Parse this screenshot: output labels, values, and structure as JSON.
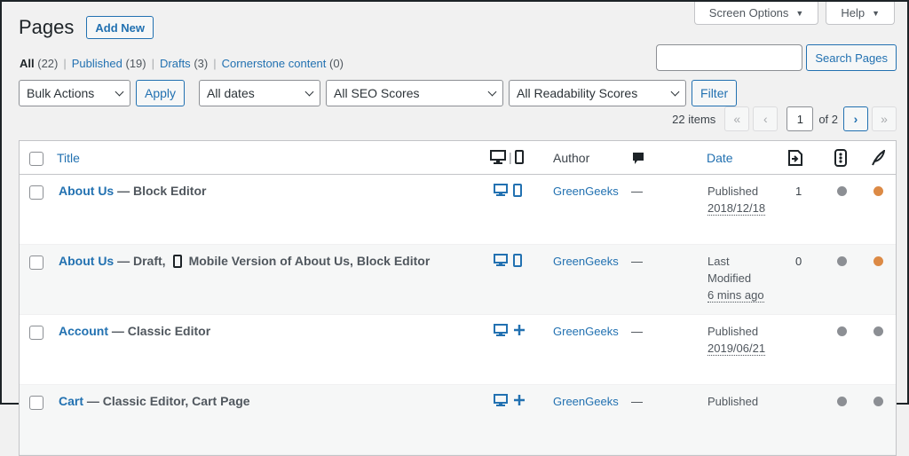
{
  "top_tabs": [
    {
      "label": "Screen Options"
    },
    {
      "label": "Help"
    }
  ],
  "page_title": "Pages",
  "add_new_label": "Add New",
  "views": [
    {
      "label": "All",
      "count": "(22)"
    },
    {
      "label": "Published",
      "count": "(19)"
    },
    {
      "label": "Drafts",
      "count": "(3)"
    },
    {
      "label": "Cornerstone content",
      "count": "(0)"
    }
  ],
  "search_button_label": "Search Pages",
  "search_value": "",
  "filters": {
    "bulk_actions": "Bulk Actions",
    "apply_label": "Apply",
    "dates": "All dates",
    "seo": "All SEO Scores",
    "readability": "All Readability Scores",
    "filter_label": "Filter"
  },
  "pagination": {
    "items": "22 items",
    "current_page": "1",
    "of_text": "of 2",
    "first": "«",
    "prev": "‹",
    "next": "›",
    "last": "»"
  },
  "columns": {
    "title": "Title",
    "author": "Author",
    "date": "Date"
  },
  "rows": [
    {
      "title": "About Us",
      "state": " — Block Editor",
      "state_extra": "",
      "author": "GreenGeeks",
      "comments": "—",
      "date_status": "Published",
      "date_value": "2018/12/18",
      "date_line3": "",
      "links": "1",
      "second_device": "mobile",
      "seo_color": "#8c8f94",
      "read_color": "#dc8a45"
    },
    {
      "title": "About Us",
      "state": " — Draft,",
      "state_extra": "Mobile Version of About Us, Block Editor",
      "author": "GreenGeeks",
      "comments": "—",
      "date_status": "Last",
      "date_value": "Modified",
      "date_line3": "6 mins ago",
      "links": "0",
      "second_device": "mobile",
      "seo_color": "#8c8f94",
      "read_color": "#dc8a45"
    },
    {
      "title": "Account",
      "state": " — Classic Editor",
      "state_extra": "",
      "author": "GreenGeeks",
      "comments": "—",
      "date_status": "Published",
      "date_value": "2019/06/21",
      "date_line3": "",
      "links": "",
      "second_device": "plus",
      "seo_color": "#8c8f94",
      "read_color": "#8c8f94"
    },
    {
      "title": "Cart",
      "state": " — Classic Editor, Cart Page",
      "state_extra": "",
      "author": "GreenGeeks",
      "comments": "—",
      "date_status": "Published",
      "date_value": "",
      "date_line3": "",
      "links": "",
      "second_device": "plus",
      "seo_color": "#8c8f94",
      "read_color": "#8c8f94"
    }
  ],
  "colors": {
    "accent": "#2271b1",
    "border": "#c3c4c7",
    "text": "#50575e"
  }
}
